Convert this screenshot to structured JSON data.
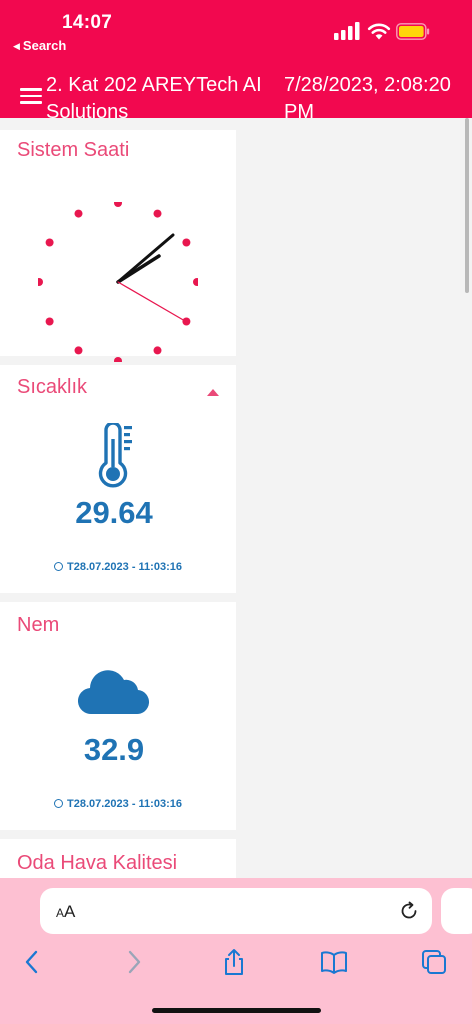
{
  "status_bar": {
    "time": "14:07",
    "back_label": "Search"
  },
  "header": {
    "title": "2. Kat 202 AREYTech AI Solutions",
    "datetime": "7/28/2023, 2:08:20 PM"
  },
  "cards": {
    "clock": {
      "title": "Sistem Saati",
      "time_shown": "14:08:20"
    },
    "temperature": {
      "title": "Sıcaklık",
      "value": "29.64",
      "timestamp": "T28.07.2023 - 11:03:16",
      "icon": "thermometer-icon"
    },
    "humidity": {
      "title": "Nem",
      "value": "32.9",
      "timestamp": "T28.07.2023 - 11:03:16",
      "icon": "cloud-icon"
    },
    "air_quality": {
      "title": "Oda Hava Kalitesi"
    }
  },
  "browser": {
    "text_size_label_small": "A",
    "text_size_label_big": "A"
  },
  "colors": {
    "brand_pink": "#f2084f",
    "title_pink": "#ea4a78",
    "value_blue": "#1f73b4",
    "bottom_bar": "#fdc0d2"
  }
}
